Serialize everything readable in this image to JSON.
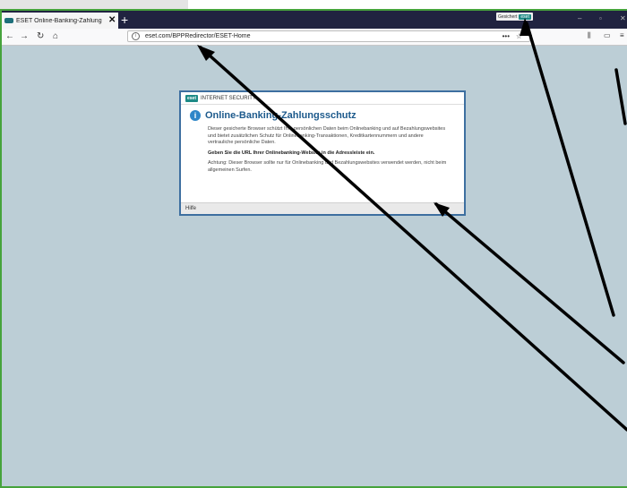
{
  "browser": {
    "tab_title": "ESET Online-Banking-Zahlung",
    "tab_close": "✕",
    "new_tab": "+",
    "secured_label": "Gesichert",
    "secured_logo": "eset",
    "url": "eset.com/BPPRedirector/ESET-Home",
    "url_more": "•••",
    "url_star": "☆"
  },
  "dialog": {
    "brand": "INTERNET SECURITY",
    "logo": "eset",
    "title": "Online-Banking-Zahlungsschutz",
    "para1": "Dieser gesicherte Browser schützt Ihre persönlichen Daten beim Onlinebanking und auf Bezahlungswebsites und bietet zusätzlichen Schutz für Onlinebanking-Transaktionen, Kreditkartennummern und andere vertrauliche persönliche Daten.",
    "para2": "Geben Sie die URL Ihrer Onlinebanking-Website in die Adressleiste ein.",
    "para3": "Achtung: Dieser Browser sollte nur für Onlinebanking und Bezahlungswebsites verwendet werden, nicht beim allgemeinen Surfen.",
    "footer_link": "Hilfe"
  },
  "icons": [
    "eset-tab-icon",
    "back-arrow-icon",
    "forward-arrow-icon",
    "reload-icon",
    "home-icon",
    "info-icon",
    "more-icon",
    "star-icon",
    "library-icon",
    "sidebar-icon",
    "menu-icon"
  ]
}
